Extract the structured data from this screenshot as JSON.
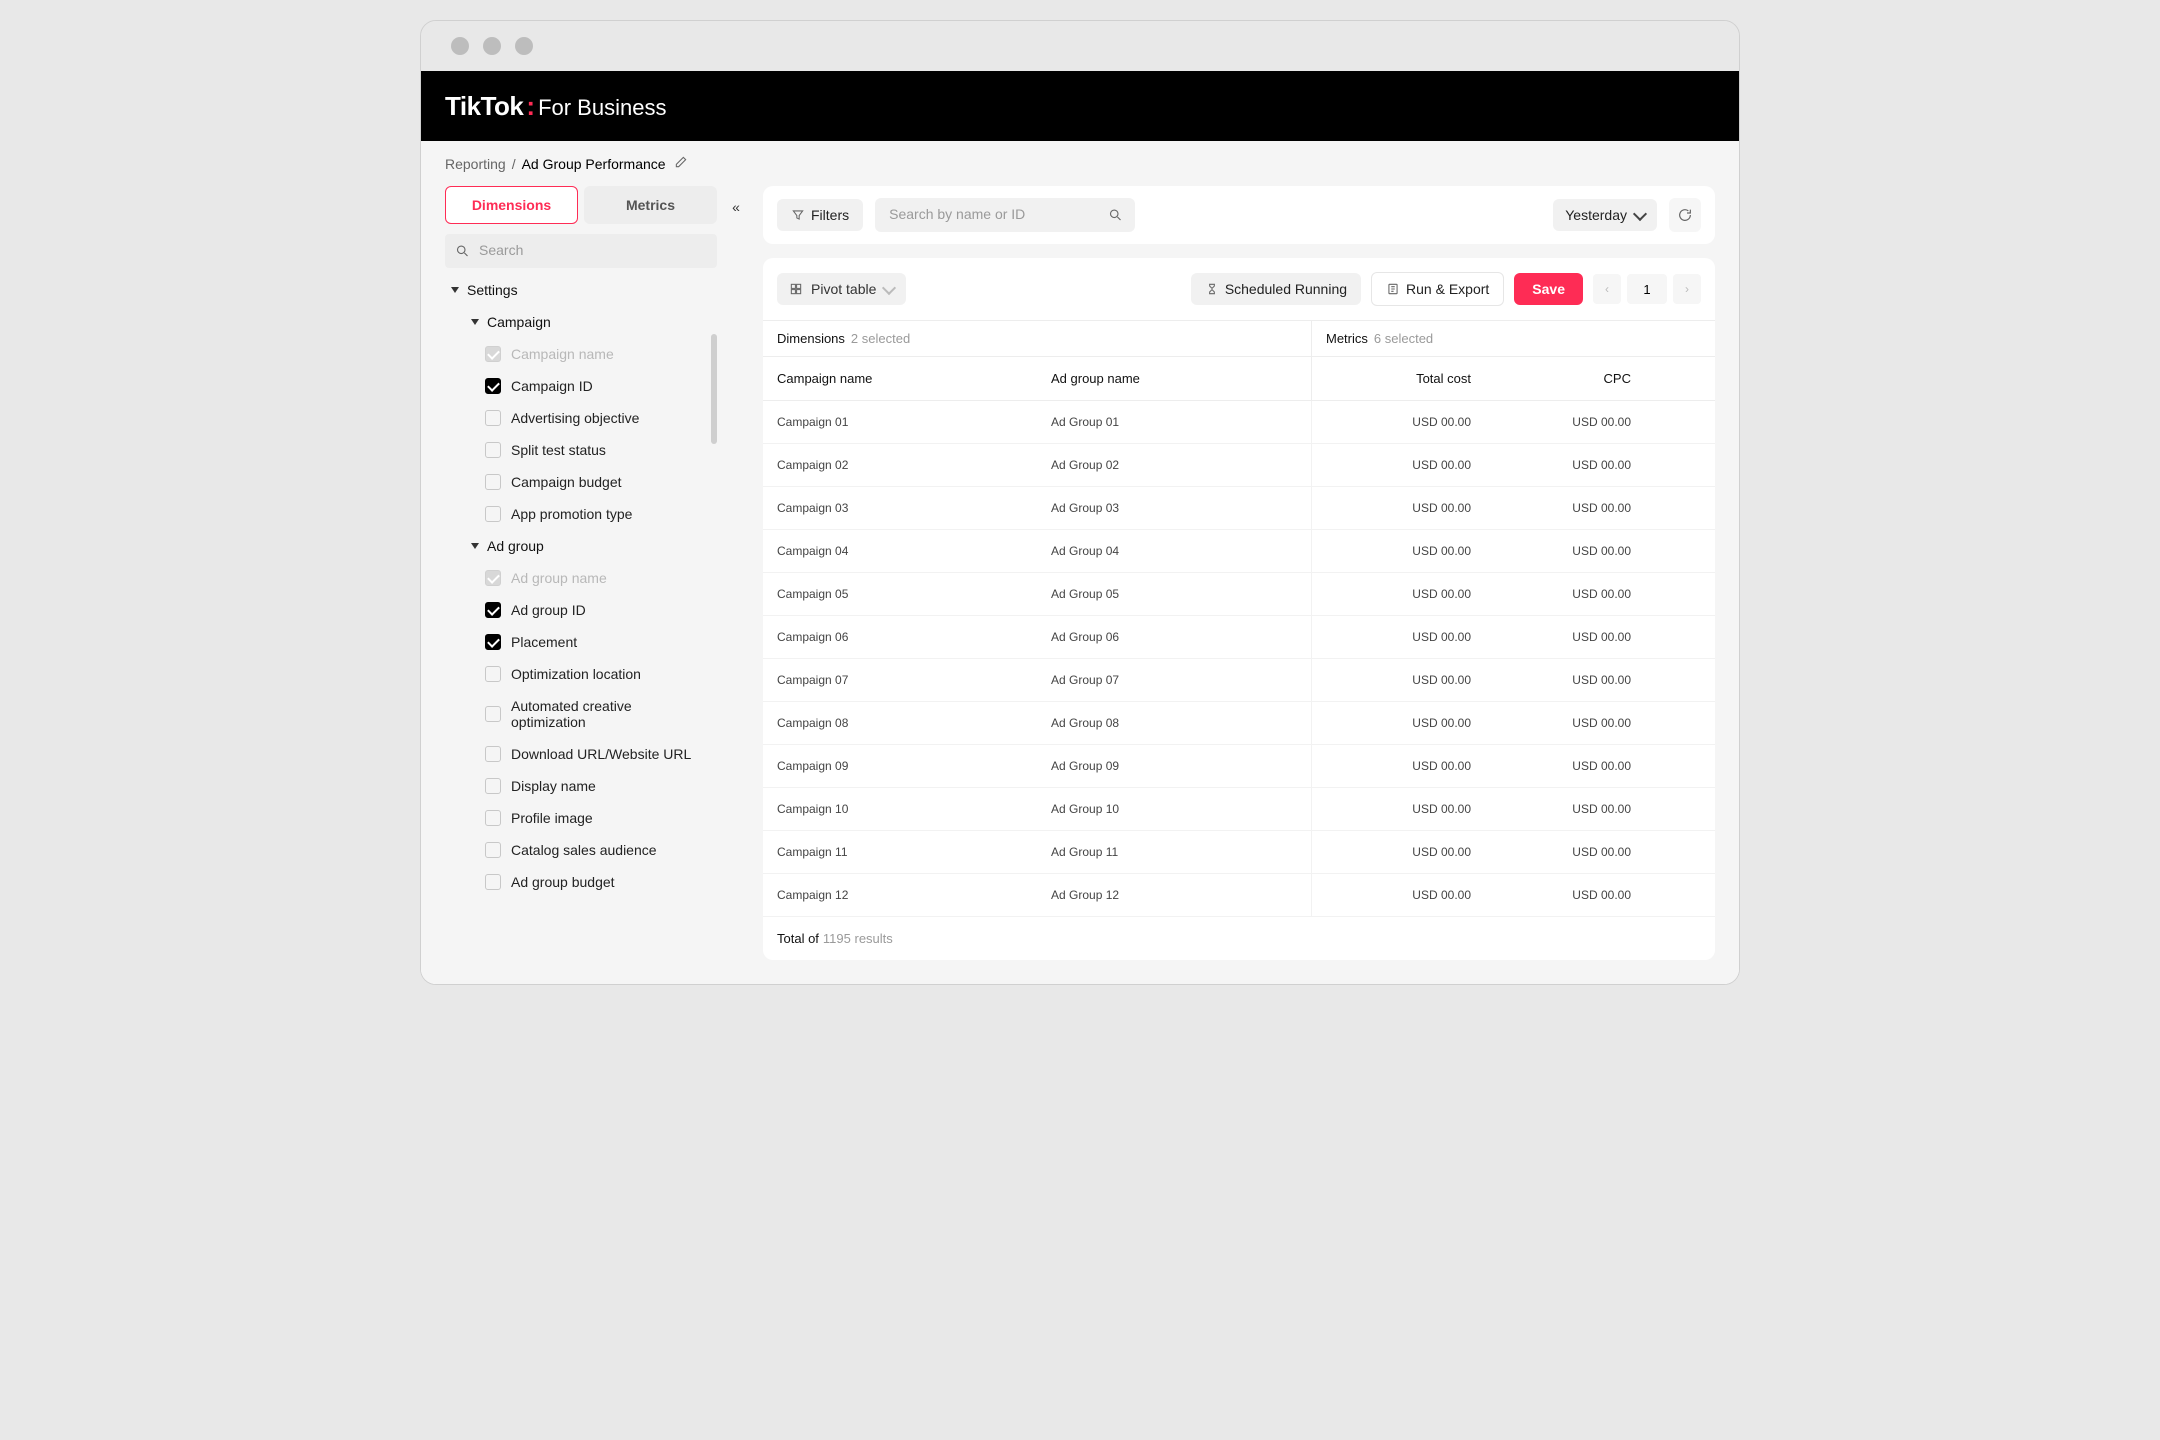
{
  "brand": {
    "name": "TikTok",
    "suffix": "For Business"
  },
  "breadcrumb": {
    "parent": "Reporting",
    "current": "Ad Group Performance"
  },
  "sidebar": {
    "tabs": {
      "dimensions": "Dimensions",
      "metrics": "Metrics"
    },
    "search_placeholder": "Search",
    "settings_label": "Settings",
    "campaign_label": "Campaign",
    "adgroup_label": "Ad group",
    "campaign_items": [
      {
        "label": "Campaign name",
        "checked": true,
        "disabled": true
      },
      {
        "label": "Campaign ID",
        "checked": true,
        "disabled": false
      },
      {
        "label": "Advertising objective",
        "checked": false,
        "disabled": false
      },
      {
        "label": "Split test status",
        "checked": false,
        "disabled": false
      },
      {
        "label": "Campaign budget",
        "checked": false,
        "disabled": false
      },
      {
        "label": "App promotion type",
        "checked": false,
        "disabled": false
      }
    ],
    "adgroup_items": [
      {
        "label": "Ad group name",
        "checked": true,
        "disabled": true
      },
      {
        "label": "Ad group ID",
        "checked": true,
        "disabled": false
      },
      {
        "label": "Placement",
        "checked": true,
        "disabled": false
      },
      {
        "label": "Optimization location",
        "checked": false,
        "disabled": false
      },
      {
        "label": "Automated creative optimization",
        "checked": false,
        "disabled": false
      },
      {
        "label": "Download URL/Website URL",
        "checked": false,
        "disabled": false
      },
      {
        "label": "Display name",
        "checked": false,
        "disabled": false
      },
      {
        "label": "Profile image",
        "checked": false,
        "disabled": false
      },
      {
        "label": "Catalog sales audience",
        "checked": false,
        "disabled": false
      },
      {
        "label": "Ad group budget",
        "checked": false,
        "disabled": false
      }
    ]
  },
  "topbar": {
    "filters": "Filters",
    "search_placeholder": "Search by name or ID",
    "date": "Yesterday"
  },
  "toolbar": {
    "pivot": "Pivot table",
    "scheduled": "Scheduled Running",
    "run_export": "Run & Export",
    "save": "Save",
    "page": "1"
  },
  "table": {
    "dim_label": "Dimensions",
    "dim_count": "2 selected",
    "met_label": "Metrics",
    "met_count": "6 selected",
    "headers": {
      "campaign": "Campaign name",
      "adgroup": "Ad group name",
      "cost": "Total cost",
      "cpc": "CPC"
    },
    "rows": [
      {
        "c": "Campaign 01",
        "a": "Ad Group 01",
        "cost": "USD 00.00",
        "cpc": "USD 00.00"
      },
      {
        "c": "Campaign 02",
        "a": "Ad Group 02",
        "cost": "USD 00.00",
        "cpc": "USD 00.00"
      },
      {
        "c": "Campaign 03",
        "a": "Ad Group 03",
        "cost": "USD 00.00",
        "cpc": "USD 00.00"
      },
      {
        "c": "Campaign 04",
        "a": "Ad Group 04",
        "cost": "USD 00.00",
        "cpc": "USD 00.00"
      },
      {
        "c": "Campaign 05",
        "a": "Ad Group 05",
        "cost": "USD 00.00",
        "cpc": "USD 00.00"
      },
      {
        "c": "Campaign 06",
        "a": "Ad Group 06",
        "cost": "USD 00.00",
        "cpc": "USD 00.00"
      },
      {
        "c": "Campaign 07",
        "a": "Ad Group 07",
        "cost": "USD 00.00",
        "cpc": "USD 00.00"
      },
      {
        "c": "Campaign 08",
        "a": "Ad Group 08",
        "cost": "USD 00.00",
        "cpc": "USD 00.00"
      },
      {
        "c": "Campaign 09",
        "a": "Ad Group 09",
        "cost": "USD 00.00",
        "cpc": "USD 00.00"
      },
      {
        "c": "Campaign 10",
        "a": "Ad Group 10",
        "cost": "USD 00.00",
        "cpc": "USD 00.00"
      },
      {
        "c": "Campaign 11",
        "a": "Ad Group 11",
        "cost": "USD 00.00",
        "cpc": "USD 00.00"
      },
      {
        "c": "Campaign 12",
        "a": "Ad Group 12",
        "cost": "USD 00.00",
        "cpc": "USD 00.00"
      }
    ],
    "footer": {
      "label": "Total of",
      "count": "1195 results"
    }
  }
}
